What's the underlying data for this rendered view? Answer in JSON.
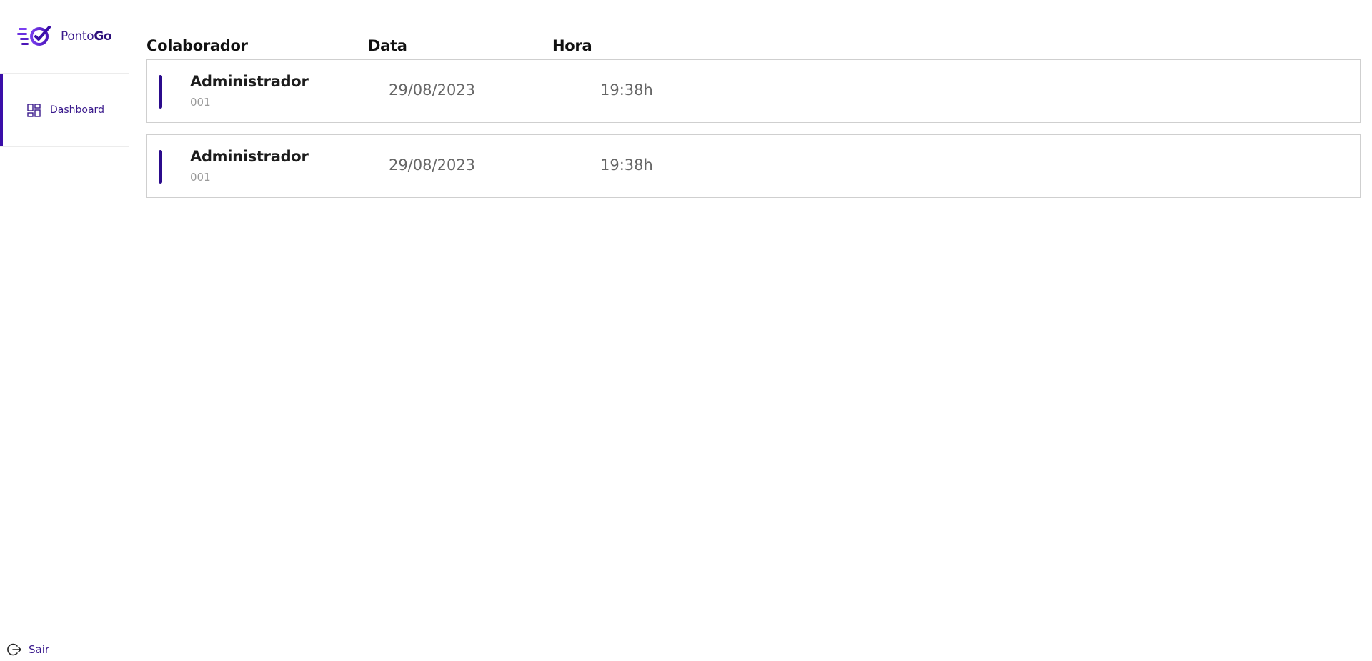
{
  "brand": {
    "name_regular": "Ponto",
    "name_bold": "Go",
    "accent": "#3a0ea8",
    "logo_icon": "speed-check-logo-icon"
  },
  "sidebar": {
    "items": [
      {
        "label": "Dashboard",
        "icon": "dashboard-icon",
        "active": true
      }
    ],
    "logout": {
      "label": "Sair",
      "icon": "logout-icon"
    }
  },
  "table": {
    "headers": {
      "colaborador": "Colaborador",
      "data": "Data",
      "hora": "Hora"
    },
    "rows": [
      {
        "name": "Administrador",
        "code": "001",
        "date": "29/08/2023",
        "time": "19:38h"
      },
      {
        "name": "Administrador",
        "code": "001",
        "date": "29/08/2023",
        "time": "19:38h"
      }
    ]
  }
}
